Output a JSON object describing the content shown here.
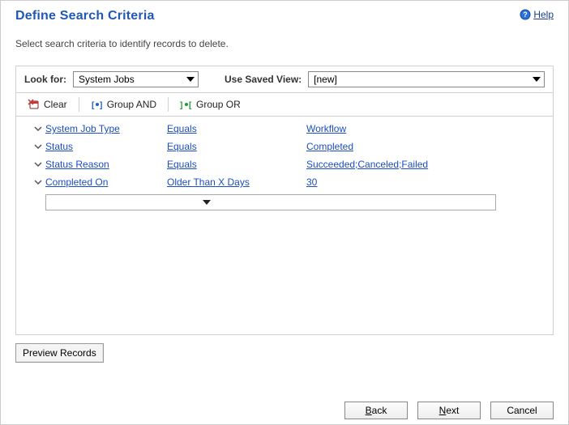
{
  "header": {
    "title": "Define Search Criteria",
    "help_label": "Help"
  },
  "subtitle": "Select search criteria to identify records to delete.",
  "lookup": {
    "look_for_label": "Look for:",
    "look_for_value": "System Jobs",
    "saved_view_label": "Use Saved View:",
    "saved_view_value": "[new]"
  },
  "toolbar": {
    "clear": "Clear",
    "group_and": "Group AND",
    "group_or": "Group OR"
  },
  "criteria": {
    "rows": [
      {
        "field": "System Job Type",
        "op": "Equals",
        "val": "Workflow"
      },
      {
        "field": "Status",
        "op": "Equals",
        "val": "Completed"
      },
      {
        "field": "Status Reason",
        "op": "Equals",
        "val": "Succeeded;Canceled;Failed"
      },
      {
        "field": "Completed On",
        "op": "Older Than X Days",
        "val": "30"
      }
    ]
  },
  "footer": {
    "preview": "Preview Records",
    "back": "Back",
    "next": "Next",
    "cancel": "Cancel"
  },
  "icons": {
    "help": "help-icon",
    "clear": "clear-icon",
    "group_and": "group-and-icon",
    "group_or": "group-or-icon",
    "chevron": "chevron-down-icon"
  }
}
